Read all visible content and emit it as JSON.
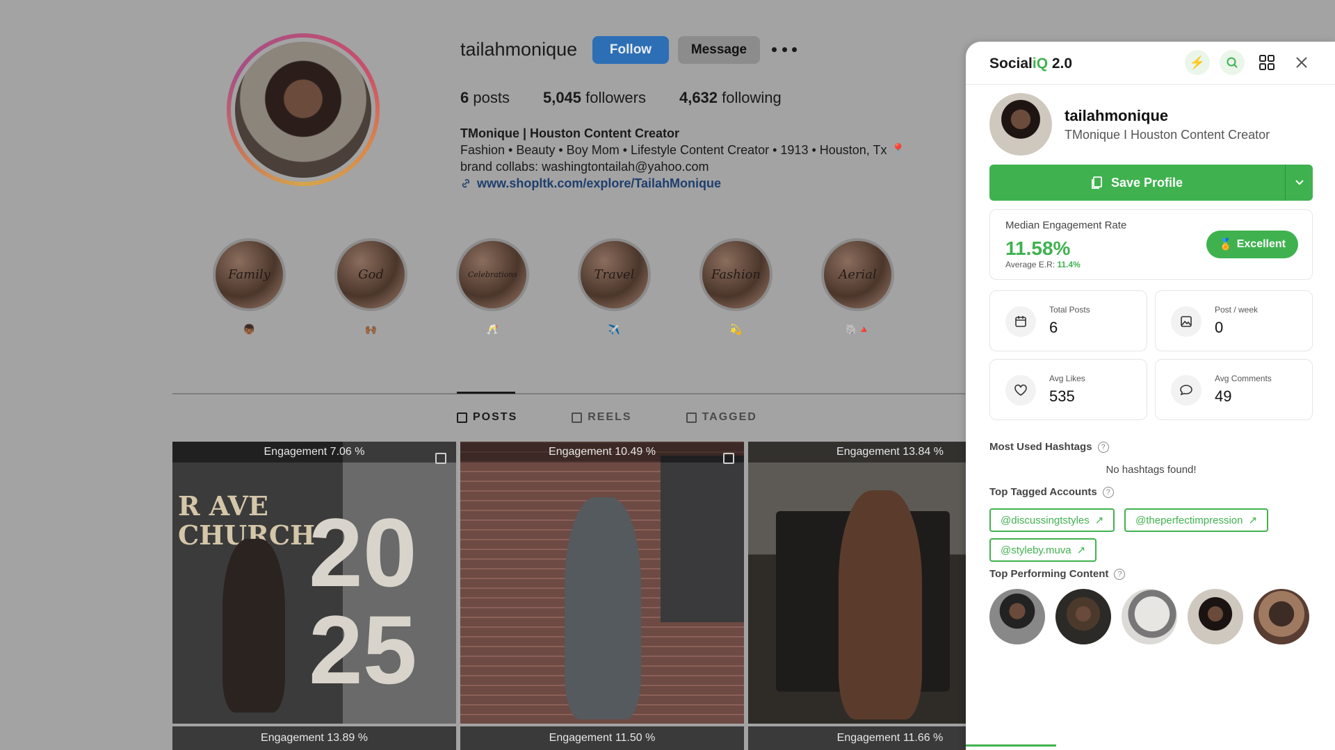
{
  "profile": {
    "username": "tailahmonique",
    "follow_label": "Follow",
    "message_label": "Message",
    "stats": {
      "posts": "6",
      "posts_label": "posts",
      "followers": "5,045",
      "followers_label": "followers",
      "following": "4,632",
      "following_label": "following"
    },
    "bio": {
      "name": "TMonique | Houston Content Creator",
      "line1": "Fashion • Beauty • Boy Mom • Lifestyle Content Creator • 1913 • Houston, Tx 📍",
      "line2": "brand collabs: washingtontailah@yahoo.com",
      "link": "www.shopltk.com/explore/TailahMonique"
    },
    "highlights": [
      {
        "title": "Family",
        "emoji": "👦🏾"
      },
      {
        "title": "God",
        "emoji": "🙌🏾"
      },
      {
        "title": "Celebrations",
        "emoji": "🥂"
      },
      {
        "title": "Travel",
        "emoji": "✈️"
      },
      {
        "title": "Fashion",
        "emoji": "💫"
      },
      {
        "title": "Aerial",
        "emoji": "🐘🔺"
      }
    ],
    "tabs": [
      "POSTS",
      "REELS",
      "TAGGED"
    ],
    "posts": [
      {
        "engagement": "Engagement 7.06 %"
      },
      {
        "engagement": "Engagement 10.49 %"
      },
      {
        "engagement": "Engagement 13.84 %"
      },
      {
        "engagement": "Engagement 13.89 %"
      },
      {
        "engagement": "Engagement 11.50 %"
      },
      {
        "engagement": "Engagement 11.66 %"
      }
    ],
    "post1_text": {
      "top": "R   AVE",
      "mid": "CHURCH",
      "year_a": "20",
      "year_b": "25"
    }
  },
  "panel": {
    "brand_prefix": "Social",
    "brand_iq": "iQ",
    "brand_version": " 2.0",
    "username": "tailahmonique",
    "display_name": "TMonique I Houston Content Creator",
    "save_label": "Save Profile",
    "engagement": {
      "label": "Median Engagement Rate",
      "value": "11.58%",
      "avg_label": "Average E.R: ",
      "avg_value": "11.4%",
      "badge": "Excellent"
    },
    "stats": [
      {
        "label": "Total Posts",
        "value": "6",
        "icon": "calendar-icon"
      },
      {
        "label": "Post / week",
        "value": "0",
        "icon": "image-icon"
      },
      {
        "label": "Avg Likes",
        "value": "535",
        "icon": "heart-icon"
      },
      {
        "label": "Avg Comments",
        "value": "49",
        "icon": "comment-icon"
      }
    ],
    "hashtags_title": "Most Used Hashtags",
    "hashtags_empty": "No hashtags found!",
    "tagged_title": "Top Tagged Accounts",
    "tagged": [
      "@discussingtstyles",
      "@theperfectimpression",
      "@styleby.muva"
    ],
    "top_content_title": "Top Performing Content",
    "accent_color": "#3fb24f"
  }
}
